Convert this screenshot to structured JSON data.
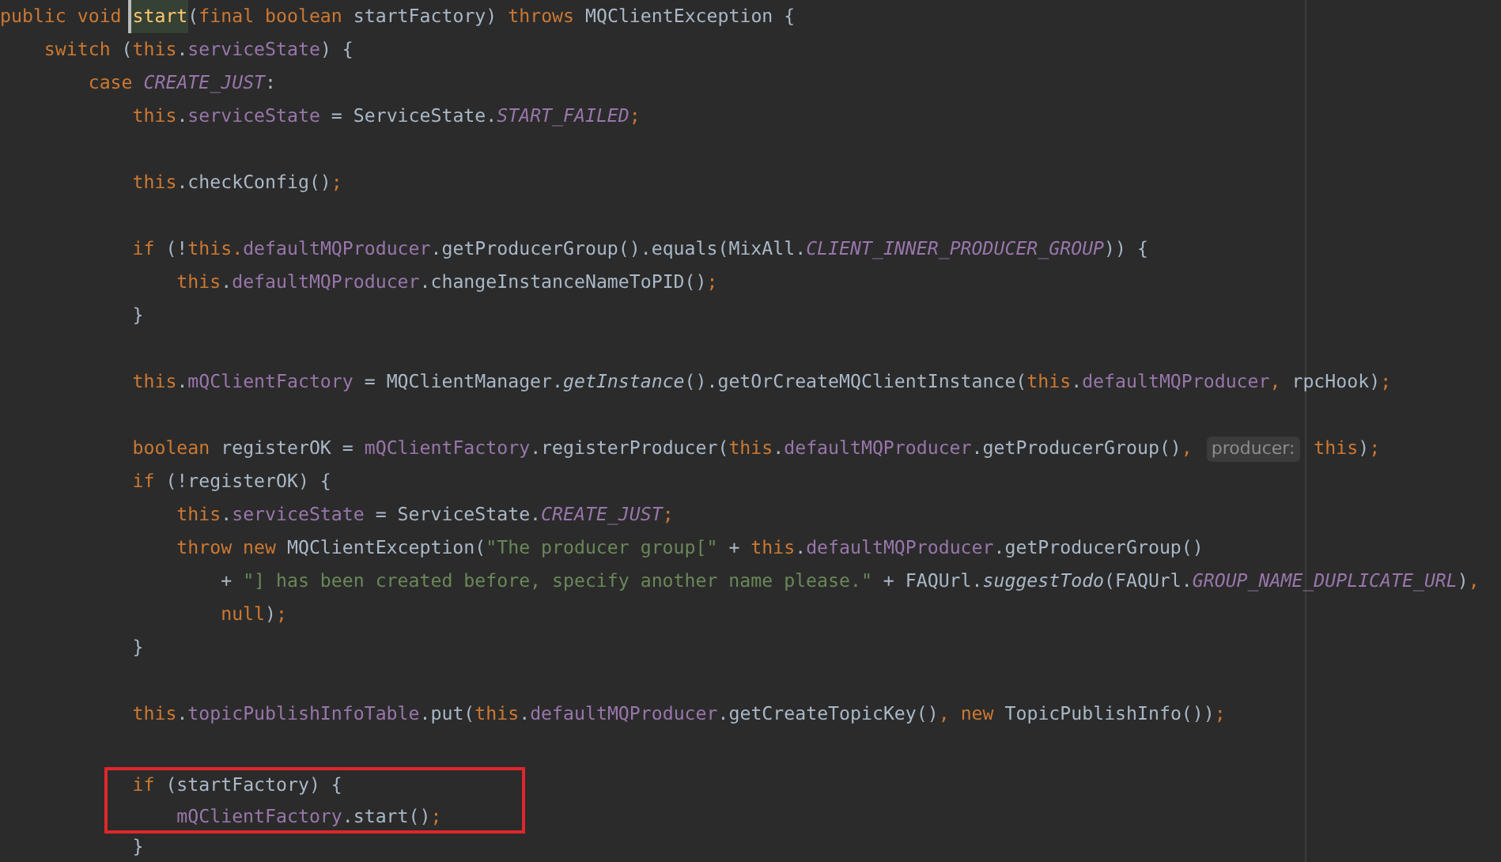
{
  "editor": {
    "lines": [
      {
        "kind": "code",
        "tokens": [
          {
            "kind": "keyword",
            "text": "public void "
          },
          {
            "kind": "declaration",
            "text": "start",
            "caret": true
          },
          {
            "kind": "plain",
            "text": "("
          },
          {
            "kind": "keyword",
            "text": "final boolean "
          },
          {
            "kind": "plain",
            "text": "startFactory) "
          },
          {
            "kind": "keyword",
            "text": "throws "
          },
          {
            "kind": "plain",
            "text": "MQClientException {"
          }
        ]
      },
      {
        "kind": "code",
        "tokens": [
          {
            "kind": "keyword",
            "text": "    switch "
          },
          {
            "kind": "plain",
            "text": "("
          },
          {
            "kind": "keyword",
            "text": "this"
          },
          {
            "kind": "plain",
            "text": "."
          },
          {
            "kind": "field",
            "text": "serviceState"
          },
          {
            "kind": "plain",
            "text": ") {"
          }
        ]
      },
      {
        "kind": "code",
        "tokens": [
          {
            "kind": "keyword",
            "text": "        case "
          },
          {
            "kind": "constant",
            "text": "CREATE_JUST"
          },
          {
            "kind": "plain",
            "text": ":"
          }
        ]
      },
      {
        "kind": "code",
        "tokens": [
          {
            "kind": "keyword",
            "text": "            this"
          },
          {
            "kind": "plain",
            "text": "."
          },
          {
            "kind": "field",
            "text": "serviceState"
          },
          {
            "kind": "plain",
            "text": " = ServiceState."
          },
          {
            "kind": "constant",
            "text": "START_FAILED"
          },
          {
            "kind": "punct",
            "text": ";"
          }
        ]
      },
      {
        "kind": "blank"
      },
      {
        "kind": "code",
        "tokens": [
          {
            "kind": "keyword",
            "text": "            this"
          },
          {
            "kind": "plain",
            "text": ".checkConfig()"
          },
          {
            "kind": "punct",
            "text": ";"
          }
        ]
      },
      {
        "kind": "blank"
      },
      {
        "kind": "code",
        "tokens": [
          {
            "kind": "keyword",
            "text": "            if "
          },
          {
            "kind": "plain",
            "text": "(!"
          },
          {
            "kind": "keyword",
            "text": "this."
          },
          {
            "kind": "field",
            "text": "defaultMQProducer"
          },
          {
            "kind": "plain",
            "text": ".getProducerGroup().equals(MixAll."
          },
          {
            "kind": "constant",
            "text": "CLIENT_INNER_PRODUCER_GROUP"
          },
          {
            "kind": "plain",
            "text": ")) {"
          }
        ]
      },
      {
        "kind": "code",
        "tokens": [
          {
            "kind": "keyword",
            "text": "                this"
          },
          {
            "kind": "plain",
            "text": "."
          },
          {
            "kind": "field",
            "text": "defaultMQProducer"
          },
          {
            "kind": "plain",
            "text": ".changeInstanceNameToPID()"
          },
          {
            "kind": "punct",
            "text": ";"
          }
        ]
      },
      {
        "kind": "code",
        "tokens": [
          {
            "kind": "plain",
            "text": "            }"
          }
        ]
      },
      {
        "kind": "blank"
      },
      {
        "kind": "code",
        "tokens": [
          {
            "kind": "keyword",
            "text": "            this"
          },
          {
            "kind": "plain",
            "text": "."
          },
          {
            "kind": "field",
            "text": "mQClientFactory"
          },
          {
            "kind": "plain",
            "text": " = MQClientManager."
          },
          {
            "kind": "static",
            "text": "getInstance"
          },
          {
            "kind": "plain",
            "text": "().getOrCreateMQClientInstance("
          },
          {
            "kind": "keyword",
            "text": "this"
          },
          {
            "kind": "plain",
            "text": "."
          },
          {
            "kind": "field",
            "text": "defaultMQProducer"
          },
          {
            "kind": "punct",
            "text": ", "
          },
          {
            "kind": "plain",
            "text": "rpcHook)"
          },
          {
            "kind": "punct",
            "text": ";"
          }
        ]
      },
      {
        "kind": "blank"
      },
      {
        "kind": "code",
        "tokens": [
          {
            "kind": "keyword",
            "text": "            boolean "
          },
          {
            "kind": "plain",
            "text": "registerOK = "
          },
          {
            "kind": "field",
            "text": "mQClientFactory"
          },
          {
            "kind": "plain",
            "text": ".registerProducer("
          },
          {
            "kind": "keyword",
            "text": "this"
          },
          {
            "kind": "plain",
            "text": "."
          },
          {
            "kind": "field",
            "text": "defaultMQProducer"
          },
          {
            "kind": "plain",
            "text": ".getProducerGroup()"
          },
          {
            "kind": "punct",
            "text": ", "
          },
          {
            "kind": "hint",
            "text": "producer:"
          },
          {
            "kind": "keyword",
            "text": " this"
          },
          {
            "kind": "plain",
            "text": ")"
          },
          {
            "kind": "punct",
            "text": ";"
          }
        ]
      },
      {
        "kind": "code",
        "tokens": [
          {
            "kind": "keyword",
            "text": "            if "
          },
          {
            "kind": "plain",
            "text": "(!registerOK) {"
          }
        ]
      },
      {
        "kind": "code",
        "tokens": [
          {
            "kind": "keyword",
            "text": "                this"
          },
          {
            "kind": "plain",
            "text": "."
          },
          {
            "kind": "field",
            "text": "serviceState"
          },
          {
            "kind": "plain",
            "text": " = ServiceState."
          },
          {
            "kind": "constant",
            "text": "CREATE_JUST"
          },
          {
            "kind": "punct",
            "text": ";"
          }
        ]
      },
      {
        "kind": "code",
        "tokens": [
          {
            "kind": "keyword",
            "text": "                throw new "
          },
          {
            "kind": "plain",
            "text": "MQClientException("
          },
          {
            "kind": "string",
            "text": "\"The producer group[\""
          },
          {
            "kind": "plain",
            "text": " + "
          },
          {
            "kind": "keyword",
            "text": "this"
          },
          {
            "kind": "plain",
            "text": "."
          },
          {
            "kind": "field",
            "text": "defaultMQProducer"
          },
          {
            "kind": "plain",
            "text": ".getProducerGroup()"
          }
        ]
      },
      {
        "kind": "code",
        "tokens": [
          {
            "kind": "plain",
            "text": "                    + "
          },
          {
            "kind": "string",
            "text": "\"] has been created before, specify another name please.\""
          },
          {
            "kind": "plain",
            "text": " + FAQUrl."
          },
          {
            "kind": "static",
            "text": "suggestTodo"
          },
          {
            "kind": "plain",
            "text": "(FAQUrl."
          },
          {
            "kind": "constant",
            "text": "GROUP_NAME_DUPLICATE_URL"
          },
          {
            "kind": "plain",
            "text": ")"
          },
          {
            "kind": "punct",
            "text": ","
          }
        ]
      },
      {
        "kind": "code",
        "tokens": [
          {
            "kind": "keyword",
            "text": "                    null"
          },
          {
            "kind": "plain",
            "text": ")"
          },
          {
            "kind": "punct",
            "text": ";"
          }
        ]
      },
      {
        "kind": "code",
        "tokens": [
          {
            "kind": "plain",
            "text": "            }"
          }
        ]
      },
      {
        "kind": "blank"
      },
      {
        "kind": "code",
        "tokens": [
          {
            "kind": "keyword",
            "text": "            this"
          },
          {
            "kind": "plain",
            "text": "."
          },
          {
            "kind": "field",
            "text": "topicPublishInfoTable"
          },
          {
            "kind": "plain",
            "text": ".put("
          },
          {
            "kind": "keyword",
            "text": "this"
          },
          {
            "kind": "plain",
            "text": "."
          },
          {
            "kind": "field",
            "text": "defaultMQProducer"
          },
          {
            "kind": "plain",
            "text": ".getCreateTopicKey()"
          },
          {
            "kind": "punct",
            "text": ", "
          },
          {
            "kind": "keyword",
            "text": "new "
          },
          {
            "kind": "plain",
            "text": "TopicPublishInfo())"
          },
          {
            "kind": "punct",
            "text": ";"
          }
        ]
      },
      {
        "kind": "blank"
      },
      {
        "kind": "code",
        "boxed": true,
        "tokens": [
          {
            "kind": "keyword",
            "text": "            if "
          },
          {
            "kind": "plain",
            "text": "(startFactory) {"
          }
        ]
      },
      {
        "kind": "code",
        "boxed": true,
        "tokens": [
          {
            "kind": "field",
            "text": "                mQClientFactory"
          },
          {
            "kind": "plain",
            "text": ".start()"
          },
          {
            "kind": "punct",
            "text": ";"
          }
        ]
      },
      {
        "kind": "code",
        "tokens": [
          {
            "kind": "plain",
            "text": "            }"
          }
        ]
      }
    ]
  }
}
